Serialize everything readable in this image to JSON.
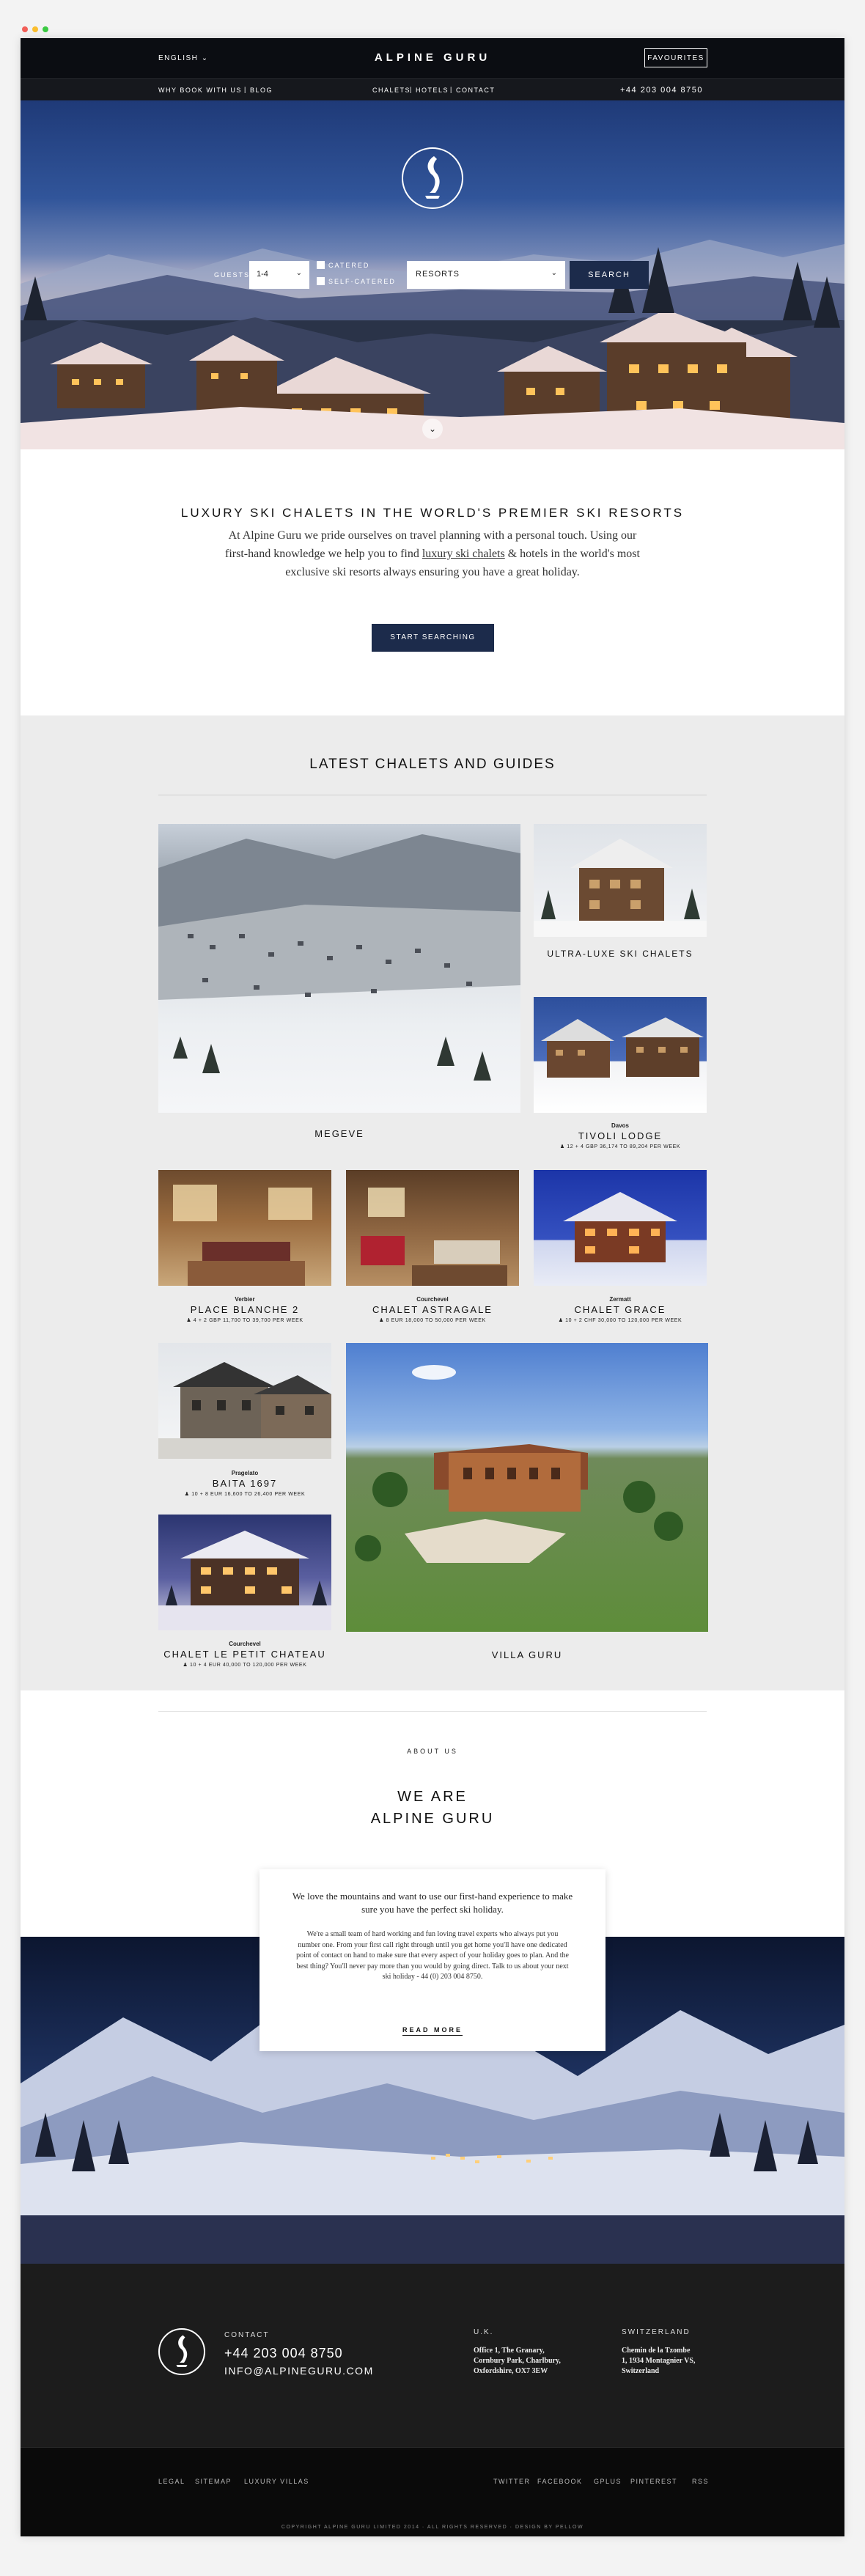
{
  "header": {
    "language": "ENGLISH",
    "brand": "ALPINE GURU",
    "favourites": "FAVOURITES",
    "sub_left": [
      "WHY BOOK WITH US",
      "BLOG"
    ],
    "sub_center": [
      "CHALETS",
      "HOTELS",
      "CONTACT"
    ],
    "phone": "+44 203 004 8750"
  },
  "search": {
    "guests_label": "GUESTS",
    "guests_value": "1-4",
    "catered": "CATERED",
    "self_catered": "SELF-CATERED",
    "resort_value": "RESORTS",
    "search_button": "SEARCH"
  },
  "intro": {
    "title": "LUXURY SKI CHALETS IN THE WORLD'S PREMIER SKI RESORTS",
    "text_before": "At Alpine Guru we pride ourselves on travel planning with a personal touch. Using our first-hand knowledge we help you to find ",
    "text_link": "luxury ski chalets",
    "text_after": " & hotels in the world's most exclusive ski resorts always ensuring you have a great holiday.",
    "cta": "START SEARCHING"
  },
  "latest": {
    "title": "LATEST CHALETS AND GUIDES",
    "cards": [
      {
        "title": "MEGEVE"
      },
      {
        "title": "ULTRA-LUXE SKI CHALETS"
      },
      {
        "location": "Davos",
        "title": "TIVOLI LODGE",
        "meta": "12 + 4   GBP 36,174 TO 89,204 PER WEEK"
      },
      {
        "location": "Verbier",
        "title": "PLACE BLANCHE 2",
        "meta": "4 + 2   GBP 11,700 TO 39,700 PER WEEK"
      },
      {
        "location": "Courchevel",
        "title": "CHALET ASTRAGALE",
        "meta": "8   EUR 18,000 TO 50,000 PER WEEK"
      },
      {
        "location": "Zermatt",
        "title": "CHALET GRACE",
        "meta": "10 + 2   CHF 30,000 TO 120,000 PER WEEK"
      },
      {
        "location": "Pragelato",
        "title": "BAITA 1697",
        "meta": "10 + 8   EUR 16,600 TO 26,400 PER WEEK"
      },
      {
        "location": "Courchevel",
        "title": "CHALET LE PETIT CHATEAU",
        "meta": "10 + 4   EUR 40,000 TO 120,000 PER WEEK"
      },
      {
        "title": "VILLA GURU"
      }
    ]
  },
  "about": {
    "label": "ABOUT US",
    "title_line1": "WE ARE",
    "title_line2": "ALPINE GURU",
    "lead": "We love the mountains and want to use our first-hand experience to make sure you have the perfect ski holiday.",
    "body": "We're a small team of hard working and fun loving travel experts who always put you number one. From your first call right through until you get home you'll have one dedicated point of contact on hand to make sure that every aspect of your holiday goes to plan. And the best thing? You'll never pay more than you would by going direct. Talk to us about your next ski holiday - 44 (0) 203 004 8750.",
    "read_more": "READ MORE"
  },
  "footer": {
    "contact_label": "CONTACT",
    "phone": "+44 203 004 8750",
    "email": "INFO@ALPINEGURU.COM",
    "uk_label": "U.K.",
    "uk_address": [
      "Office 1, The Granary,",
      "Cornbury Park, Charlbury,",
      "Oxfordshire, OX7 3EW"
    ],
    "ch_label": "SWITZERLAND",
    "ch_address": [
      "Chemin de la Tzombe",
      "1, 1934 Montagnier VS,",
      "Switzerland"
    ],
    "links_left": [
      "LEGAL",
      "SITEMAP",
      "LUXURY VILLAS"
    ],
    "links_right": [
      "TWITTER",
      "FACEBOOK",
      "GPLUS",
      "PINTEREST",
      "RSS"
    ],
    "copyright": "COPYRIGHT ALPINE GURU LIMITED 2014 · ALL RIGHTS RESERVED · DESIGN BY PELLOW"
  },
  "colors": {
    "navy": "#1c2b4b",
    "nav_black": "#0b0d12",
    "footer": "#1c1c1c",
    "section_grey": "#ececec"
  }
}
